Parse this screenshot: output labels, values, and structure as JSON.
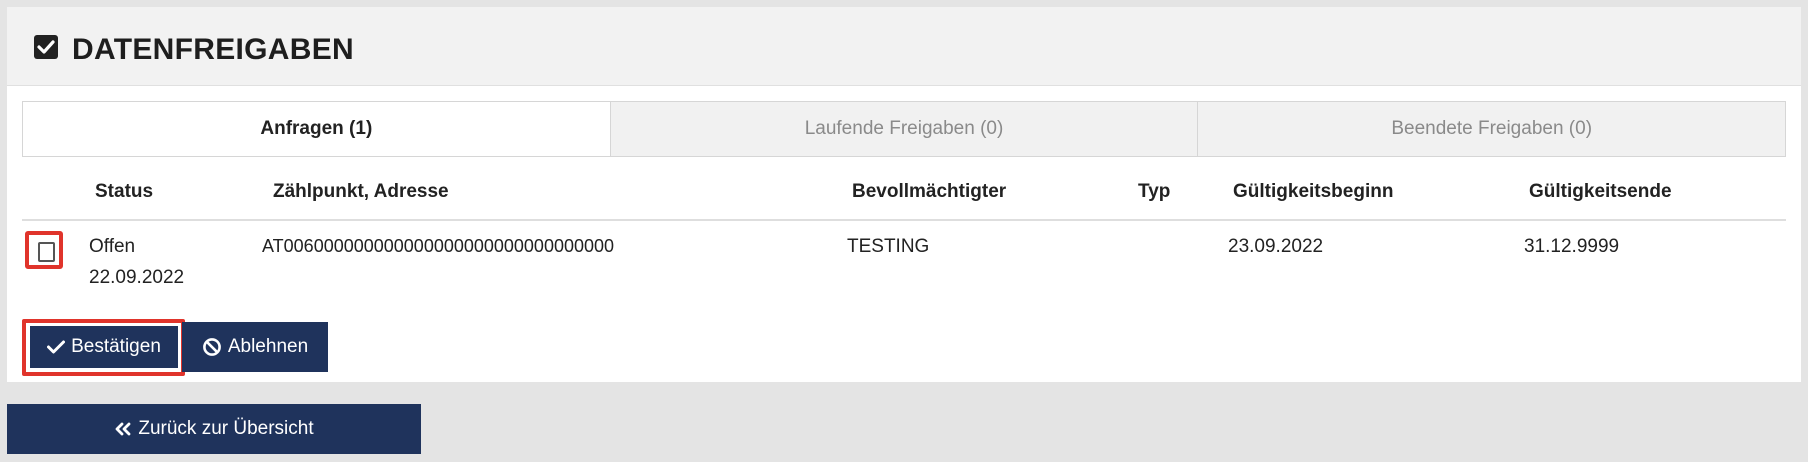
{
  "header": {
    "title": "DATENFREIGABEN",
    "icon": "checked-square-icon"
  },
  "tabs": [
    {
      "label": "Anfragen (1)",
      "active": true
    },
    {
      "label": "Laufende Freigaben (0)",
      "active": false
    },
    {
      "label": "Beendete Freigaben (0)",
      "active": false
    }
  ],
  "table": {
    "columns": [
      "Status",
      "Zählpunkt, Adresse",
      "Bevollmächtigter",
      "Typ",
      "Gültigkeitsbeginn",
      "Gültigkeitsende"
    ],
    "rows": [
      {
        "status": "Offen",
        "status_date": "22.09.2022",
        "zaehlpunkt": "AT006000000000000000000000000000000",
        "bevollmaechtigter": "TESTING",
        "typ": "",
        "beginn": "23.09.2022",
        "ende": "31.12.9999"
      }
    ]
  },
  "actions": {
    "confirm_label": "Bestätigen",
    "reject_label": "Ablehnen"
  },
  "footer": {
    "back_label": "Zurück zur Übersicht"
  },
  "colors": {
    "primary": "#1f335c",
    "highlight": "#e0342b",
    "tab_inactive_bg": "#f1f1f1"
  }
}
